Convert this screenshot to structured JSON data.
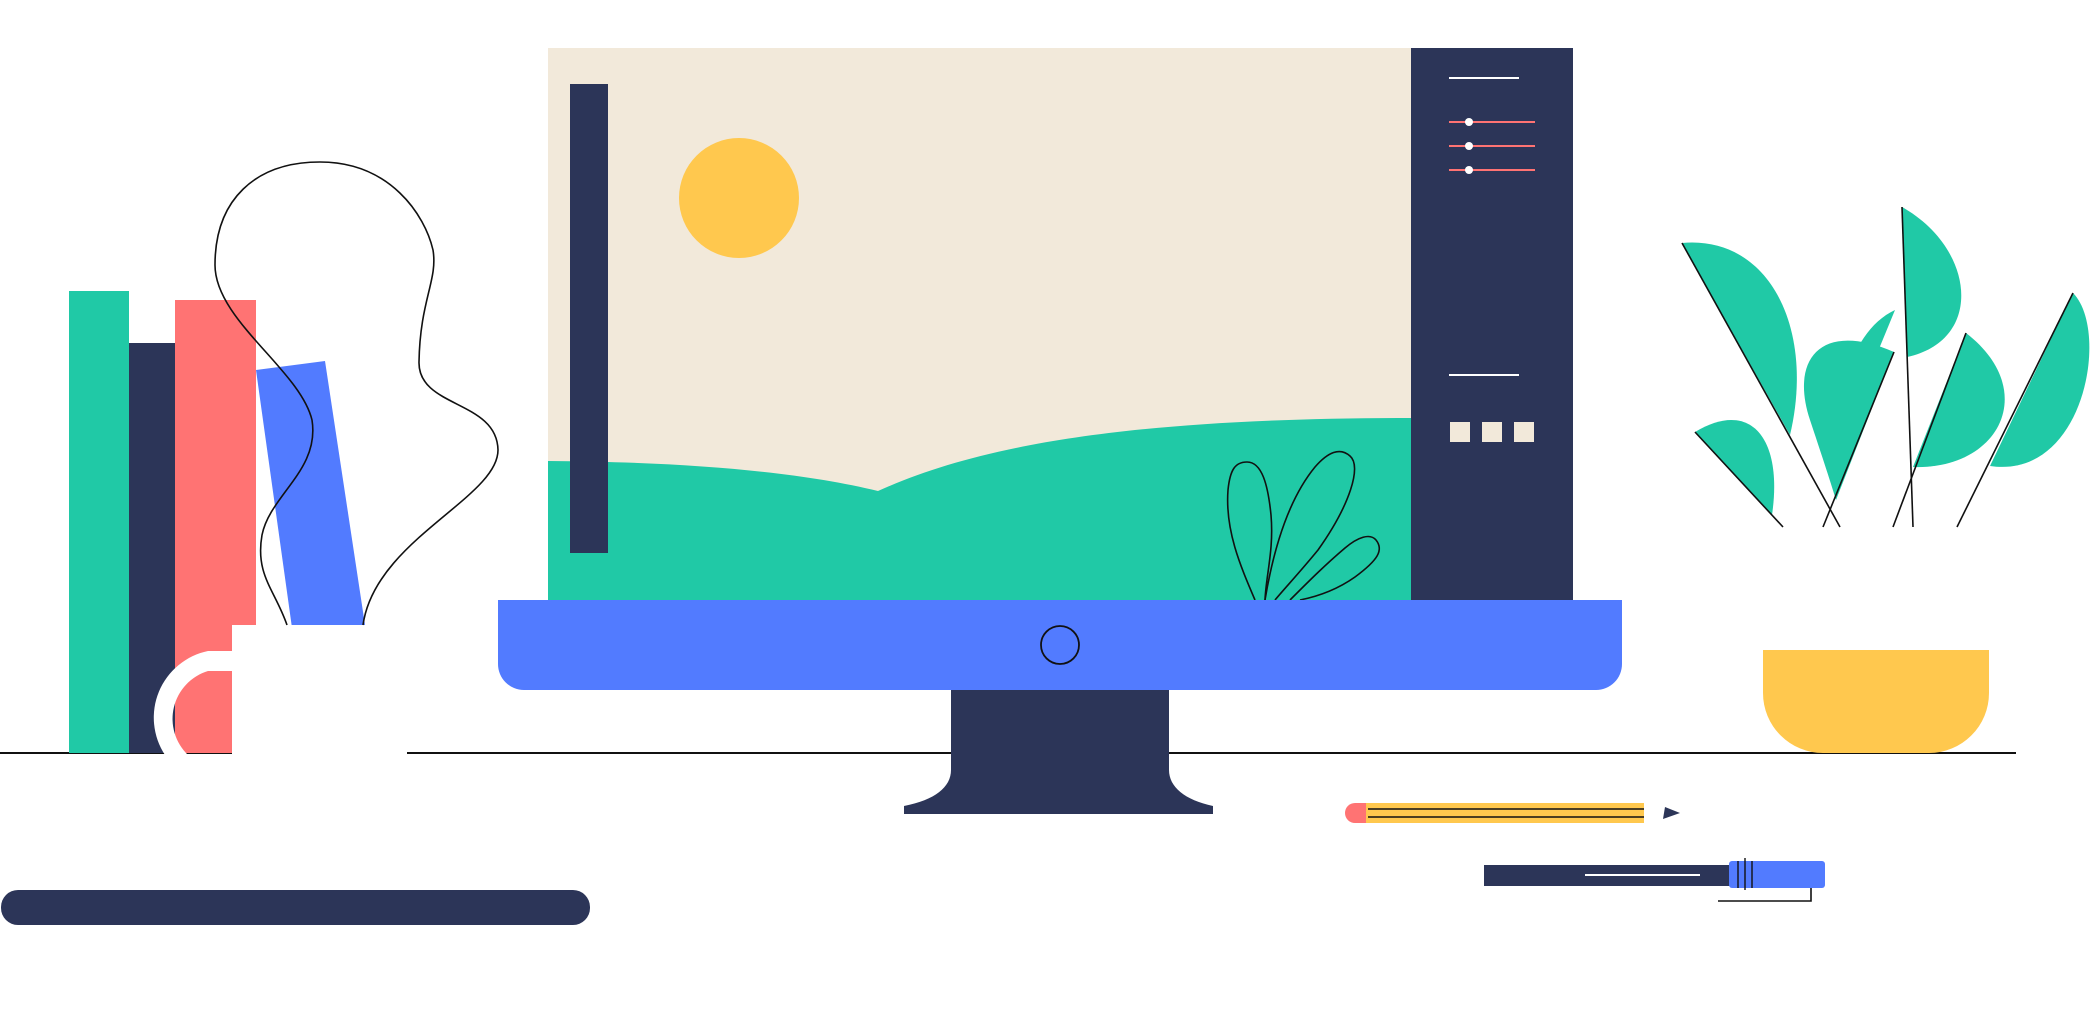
{
  "illustration": {
    "colors": {
      "navy": "#2c3558",
      "green": "#20c9a6",
      "coral": "#ff7373",
      "blue": "#527bff",
      "yellow": "#ffc84e",
      "cream": "#f2e9da",
      "white": "#ffffff",
      "line": "#111111"
    },
    "monitor": {
      "screen_sliders": 3,
      "screen_swatches": 3
    },
    "plant_leaves": 6,
    "books": 4
  }
}
